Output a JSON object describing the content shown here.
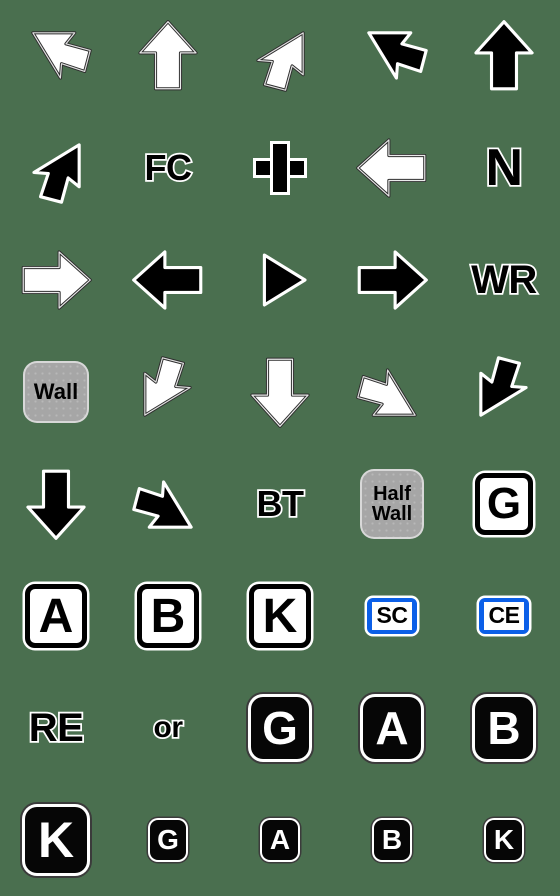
{
  "sheet": {
    "title": "Arrow and Label Emoji Sticker Sheet",
    "background_color": "#4a6f4f",
    "columns": 5,
    "rows": 8,
    "colors": {
      "background": "#4a6f4f",
      "arrow_white_fill": "#ffffff",
      "arrow_black_fill": "#000000",
      "arrow_outline": "#2b2b2b",
      "gray_box": "#a6a6a6",
      "blue_badge": "#0b5fe8",
      "text_black": "#000000",
      "text_white": "#ffffff"
    },
    "items": [
      {
        "row": 1,
        "col": 1,
        "kind": "arrow",
        "icon": "arrow-up-left-white-icon",
        "label": "white up-left arrow",
        "fill": "white",
        "rotation": -45
      },
      {
        "row": 1,
        "col": 2,
        "kind": "arrow",
        "icon": "arrow-up-white-icon",
        "label": "white up arrow",
        "fill": "white",
        "rotation": 0
      },
      {
        "row": 1,
        "col": 3,
        "kind": "arrow",
        "icon": "arrow-up-right-white-icon",
        "label": "white up-right arrow",
        "fill": "white",
        "rotation": 45
      },
      {
        "row": 1,
        "col": 4,
        "kind": "arrow",
        "icon": "arrow-up-left-black-icon",
        "label": "black up-left arrow",
        "fill": "black",
        "rotation": -45
      },
      {
        "row": 1,
        "col": 5,
        "kind": "arrow",
        "icon": "arrow-up-black-icon",
        "label": "black up arrow",
        "fill": "black",
        "rotation": 0
      },
      {
        "row": 2,
        "col": 1,
        "kind": "arrow",
        "icon": "arrow-up-right-black-icon",
        "label": "black up-right arrow",
        "fill": "black",
        "rotation": 45
      },
      {
        "row": 2,
        "col": 2,
        "kind": "otext",
        "icon": "text-fc",
        "text": "FC",
        "size": "sz-md"
      },
      {
        "row": 2,
        "col": 3,
        "kind": "plus",
        "icon": "plus-icon",
        "label": "plus sign"
      },
      {
        "row": 2,
        "col": 4,
        "kind": "arrow",
        "icon": "arrow-left-white-icon",
        "label": "white left arrow",
        "fill": "white",
        "rotation": -90
      },
      {
        "row": 2,
        "col": 5,
        "kind": "otext",
        "icon": "text-n",
        "text": "N",
        "size": "sz-n"
      },
      {
        "row": 3,
        "col": 1,
        "kind": "arrow",
        "icon": "arrow-right-white-icon",
        "label": "white right arrow",
        "fill": "white",
        "rotation": 90
      },
      {
        "row": 3,
        "col": 2,
        "kind": "arrow",
        "icon": "arrow-left-black-icon",
        "label": "black left arrow",
        "fill": "black",
        "rotation": -90
      },
      {
        "row": 3,
        "col": 3,
        "kind": "triangle",
        "icon": "play-triangle-black-icon",
        "label": "black right triangle"
      },
      {
        "row": 3,
        "col": 4,
        "kind": "arrow",
        "icon": "arrow-right-black-icon",
        "label": "black right arrow",
        "fill": "black",
        "rotation": 90
      },
      {
        "row": 3,
        "col": 5,
        "kind": "otext",
        "icon": "text-wr",
        "text": "WR",
        "size": "sz-lg"
      },
      {
        "row": 4,
        "col": 1,
        "kind": "graybox",
        "icon": "wall-label",
        "lines": [
          "Wall"
        ],
        "variant": "wall"
      },
      {
        "row": 4,
        "col": 2,
        "kind": "arrow",
        "icon": "arrow-down-left-white-icon",
        "label": "white down-left arrow",
        "fill": "white",
        "rotation": -135
      },
      {
        "row": 4,
        "col": 3,
        "kind": "arrow",
        "icon": "arrow-down-white-icon",
        "label": "white down arrow",
        "fill": "white",
        "rotation": 180
      },
      {
        "row": 4,
        "col": 4,
        "kind": "arrow",
        "icon": "arrow-down-right-white-icon",
        "label": "white down-right arrow",
        "fill": "white",
        "rotation": 135
      },
      {
        "row": 4,
        "col": 5,
        "kind": "arrow",
        "icon": "arrow-down-left-black-icon",
        "label": "black down-left arrow",
        "fill": "black",
        "rotation": -135
      },
      {
        "row": 5,
        "col": 1,
        "kind": "arrow",
        "icon": "arrow-down-black-icon",
        "label": "black down arrow",
        "fill": "black",
        "rotation": 180
      },
      {
        "row": 5,
        "col": 2,
        "kind": "arrow",
        "icon": "arrow-down-right-black-icon",
        "label": "black down-right arrow",
        "fill": "black",
        "rotation": 135
      },
      {
        "row": 5,
        "col": 3,
        "kind": "otext",
        "icon": "text-bt",
        "text": "BT",
        "size": "sz-md"
      },
      {
        "row": 5,
        "col": 4,
        "kind": "graybox",
        "icon": "half-wall-label",
        "lines": [
          "Half",
          "Wall"
        ],
        "variant": "halfwall"
      },
      {
        "row": 5,
        "col": 5,
        "kind": "wbox",
        "icon": "letter-box-g",
        "text": "G",
        "size": "sz-g"
      },
      {
        "row": 6,
        "col": 1,
        "kind": "wbox",
        "icon": "letter-box-a",
        "text": "A",
        "size": "sz-l"
      },
      {
        "row": 6,
        "col": 2,
        "kind": "wbox",
        "icon": "letter-box-b",
        "text": "B",
        "size": "sz-l"
      },
      {
        "row": 6,
        "col": 3,
        "kind": "wbox",
        "icon": "letter-box-k",
        "text": "K",
        "size": "sz-l"
      },
      {
        "row": 6,
        "col": 4,
        "kind": "bluebadge",
        "icon": "badge-sc",
        "text": "SC"
      },
      {
        "row": 6,
        "col": 5,
        "kind": "bluebadge",
        "icon": "badge-ce",
        "text": "CE"
      },
      {
        "row": 7,
        "col": 1,
        "kind": "otext",
        "icon": "text-re",
        "text": "RE",
        "size": "sz-lg"
      },
      {
        "row": 7,
        "col": 2,
        "kind": "otext",
        "icon": "text-or",
        "text": "or",
        "size": "sz-sm"
      },
      {
        "row": 7,
        "col": 3,
        "kind": "bbox",
        "icon": "black-letter-box-g",
        "text": "G",
        "size": "sz-lg"
      },
      {
        "row": 7,
        "col": 4,
        "kind": "bbox",
        "icon": "black-letter-box-a",
        "text": "A",
        "size": "sz-lg"
      },
      {
        "row": 7,
        "col": 5,
        "kind": "bbox",
        "icon": "black-letter-box-b",
        "text": "B",
        "size": "sz-lg"
      },
      {
        "row": 8,
        "col": 1,
        "kind": "bbox",
        "icon": "black-letter-box-k-large",
        "text": "K",
        "size": "sz-xl"
      },
      {
        "row": 8,
        "col": 2,
        "kind": "bbox",
        "icon": "black-letter-box-g-small",
        "text": "G",
        "size": "sz-sm"
      },
      {
        "row": 8,
        "col": 3,
        "kind": "bbox",
        "icon": "black-letter-box-a-small",
        "text": "A",
        "size": "sz-sm"
      },
      {
        "row": 8,
        "col": 4,
        "kind": "bbox",
        "icon": "black-letter-box-b-small",
        "text": "B",
        "size": "sz-sm"
      },
      {
        "row": 8,
        "col": 5,
        "kind": "bbox",
        "icon": "black-letter-box-k-small",
        "text": "K",
        "size": "sz-sm"
      }
    ]
  }
}
